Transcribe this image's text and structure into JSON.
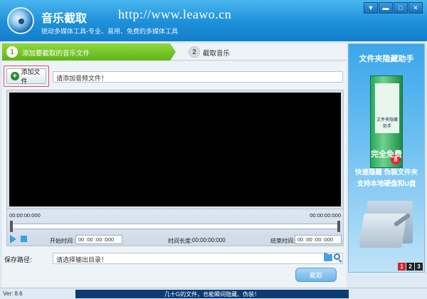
{
  "app": {
    "title": "音乐截取",
    "url": "http://www.leawo.cn",
    "subtitle": "锐动多媒体工具-专业、易用、免费的多媒体工具"
  },
  "window_controls": {
    "menu": "▼",
    "minimize": "▬",
    "maximize": "□",
    "close": "✕"
  },
  "steps": [
    {
      "number": "1",
      "label": "添加要截取的音乐文件",
      "active": true
    },
    {
      "number": "2",
      "label": "截取音乐",
      "active": false
    }
  ],
  "add_file": {
    "label": "添加文件",
    "icon": "plus-icon"
  },
  "file_input": {
    "placeholder": "请添加音频文件！"
  },
  "timeline": {
    "left_time": "00:00:00:000",
    "right_time": "00:00:00:000",
    "start_label": "开始时间:",
    "start_value": "00 :00 :00 :000",
    "length_label": "时间长度:",
    "length_value": "00:00:00:000",
    "end_label": "结束时间:",
    "end_value": "00 :00 :00 :000"
  },
  "save": {
    "label": "保存路径:",
    "placeholder": "请选择输出目录！"
  },
  "cut_button": "截取",
  "statusbar": {
    "version": "Ver: 8.6",
    "promo": "几十G的文件，也能瞬间隐藏、伪装！"
  },
  "ad": {
    "title": "文件夹隐藏助手",
    "box_text": "文件夹隐藏助手",
    "badge": "8",
    "free": "完全免费",
    "line1": "快速隐藏 伪装文件夹",
    "line2": "支持本地硬盘和U盘",
    "pages": [
      "1",
      "2",
      "3"
    ],
    "active_page": "1"
  },
  "colors": {
    "titlebar": "#1d8fd9",
    "step_active": "#5fb519",
    "accent": "#3aa0e0",
    "promo": "#0b3c74",
    "page_active": "#d8222a"
  }
}
